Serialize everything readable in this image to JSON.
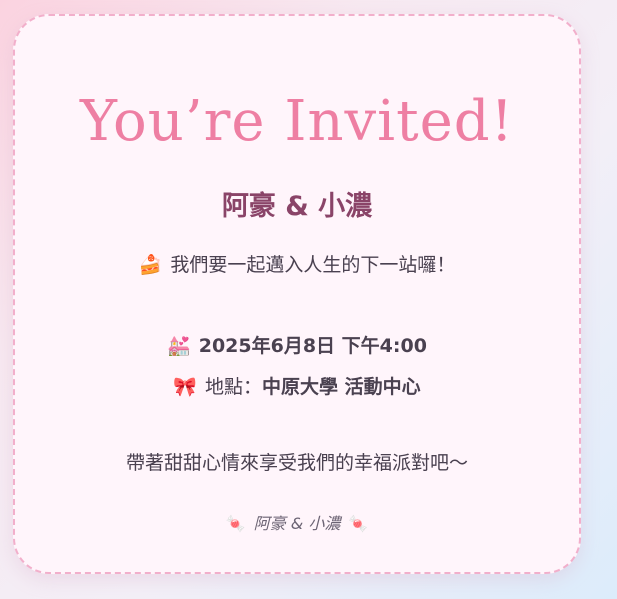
{
  "invitation": {
    "title": "You’re Invited!",
    "couple": "阿豪 & 小濃",
    "intro": {
      "icon": "cake-icon",
      "emoji": "🍰",
      "text": "我們要一起邁入人生的下一站囉！"
    },
    "date": {
      "icon": "wedding-chapel-icon",
      "emoji": "💒",
      "text": "2025年6月8日 下午4:00"
    },
    "location": {
      "icon": "ribbon-icon",
      "emoji": "🎀",
      "label": "地點：",
      "value": "中原大學 活動中心"
    },
    "message": "帶著甜甜心情來享受我們的幸福派對吧～",
    "signature": {
      "icon": "candy-icon",
      "emoji": "🍬",
      "text": "阿豪 & 小濃"
    }
  },
  "colors": {
    "title": "#ee7fa3",
    "names": "#8a4468",
    "card_bg": "#fff5fb",
    "card_border": "#f2afcb"
  }
}
